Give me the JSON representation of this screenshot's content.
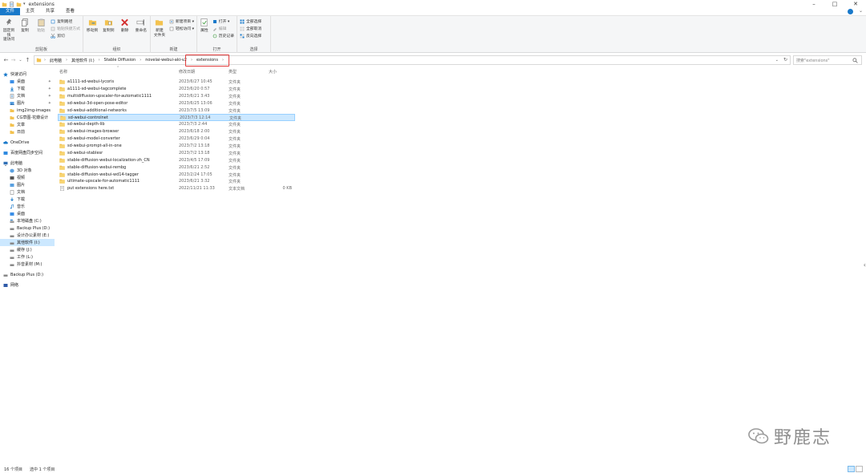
{
  "window": {
    "title": "extensions",
    "controls": [
      "–",
      "□",
      "✕"
    ]
  },
  "tabs": {
    "file": "文件",
    "home": "主页",
    "share": "共享",
    "view": "查看"
  },
  "ribbon": {
    "clipboard": {
      "label": "剪贴板",
      "pin": "固定到快\n速访问",
      "copy": "复制",
      "paste": "粘贴",
      "copy_path": "复制路径",
      "paste_shortcut": "粘贴快捷方式",
      "cut": "剪切"
    },
    "organize": {
      "label": "组织",
      "move_to": "移动到",
      "copy_to": "复制到",
      "delete": "删除",
      "rename": "重命名"
    },
    "new": {
      "label": "新建",
      "new_folder": "新建\n文件夹",
      "new_item": "新建项目 ▾",
      "easy_access": "轻松访问 ▾"
    },
    "open": {
      "label": "打开",
      "properties": "属性",
      "open": "打开 ▾",
      "edit": "编辑",
      "history": "历史记录"
    },
    "select": {
      "label": "选择",
      "select_all": "全部选择",
      "select_none": "全部取消",
      "invert": "反向选择"
    }
  },
  "address": {
    "crumbs": [
      "此电脑",
      "其他软件 (I:)",
      "Stable Diffusion",
      "novelai-webui-aki-v2",
      "extensions"
    ],
    "search_placeholder": "搜索\"extensions\""
  },
  "nav": {
    "quick_access": "快速访问",
    "items_quick": [
      "桌面",
      "下载",
      "文档",
      "图片",
      "img2img-images",
      "CG草图-花瓣设计",
      "文章",
      "日前"
    ],
    "onedrive": "OneDrive",
    "baidu": "百度网盘同步空间",
    "this_pc": "此电脑",
    "items_pc": [
      "3D 对象",
      "视频",
      "图片",
      "文档",
      "下载",
      "音乐",
      "桌面",
      "本地磁盘 (C:)",
      "Backup Plus (D:)",
      "设计办公素材 (E:)",
      "其他软件 (I:)",
      "缓存 (J:)",
      "工作 (L:)",
      "抖音素材 (M:)"
    ],
    "backup": "Backup Plus (D:)",
    "network": "网络"
  },
  "columns": {
    "name": "名称",
    "date": "修改日期",
    "type": "类型",
    "size": "大小"
  },
  "files": [
    {
      "name": "a1111-sd-webui-lycoris",
      "date": "2023/6/27 10:45",
      "type": "文件夹",
      "size": ""
    },
    {
      "name": "a1111-sd-webui-tagcomplete",
      "date": "2023/6/20 0:57",
      "type": "文件夹",
      "size": ""
    },
    {
      "name": "multidiffusion-upscaler-for-automatic1111",
      "date": "2023/6/21 3:43",
      "type": "文件夹",
      "size": ""
    },
    {
      "name": "sd-webui-3d-open-pose-editor",
      "date": "2023/6/25 13:06",
      "type": "文件夹",
      "size": ""
    },
    {
      "name": "sd-webui-additional-networks",
      "date": "2023/7/5 13:09",
      "type": "文件夹",
      "size": ""
    },
    {
      "name": "sd-webui-controlnet",
      "date": "2023/7/3 12:14",
      "type": "文件夹",
      "size": ""
    },
    {
      "name": "sd-webui-depth-lib",
      "date": "2023/7/3 2:44",
      "type": "文件夹",
      "size": ""
    },
    {
      "name": "sd-webui-images-browser",
      "date": "2023/6/18 2:00",
      "type": "文件夹",
      "size": ""
    },
    {
      "name": "sd-webui-model-converter",
      "date": "2023/6/29 0:04",
      "type": "文件夹",
      "size": ""
    },
    {
      "name": "sd-webui-prompt-all-in-one",
      "date": "2023/7/2 13:18",
      "type": "文件夹",
      "size": ""
    },
    {
      "name": "sd-webui-stablesr",
      "date": "2023/7/2 13:18",
      "type": "文件夹",
      "size": ""
    },
    {
      "name": "stable-diffusion-webui-localization-zh_CN",
      "date": "2023/4/5 17:09",
      "type": "文件夹",
      "size": ""
    },
    {
      "name": "stable-diffusion-webui-rembg",
      "date": "2023/6/21 2:52",
      "type": "文件夹",
      "size": ""
    },
    {
      "name": "stable-diffusion-webui-wd14-tagger",
      "date": "2023/2/24 17:05",
      "type": "文件夹",
      "size": ""
    },
    {
      "name": "ultimate-upscale-for-automatic1111",
      "date": "2023/6/21 3:32",
      "type": "文件夹",
      "size": ""
    },
    {
      "name": "put extensions here.txt",
      "date": "2022/11/21 11:33",
      "type": "文本文档",
      "size": "0 KB"
    }
  ],
  "status": {
    "count": "16 个项目",
    "selected": "选中 1 个项目"
  },
  "watermark": "野鹿志",
  "colors": {
    "accent": "#1979ca",
    "selection": "#cce8ff",
    "folder": "#f3c24f",
    "highlight_box": "#e03b3b"
  }
}
